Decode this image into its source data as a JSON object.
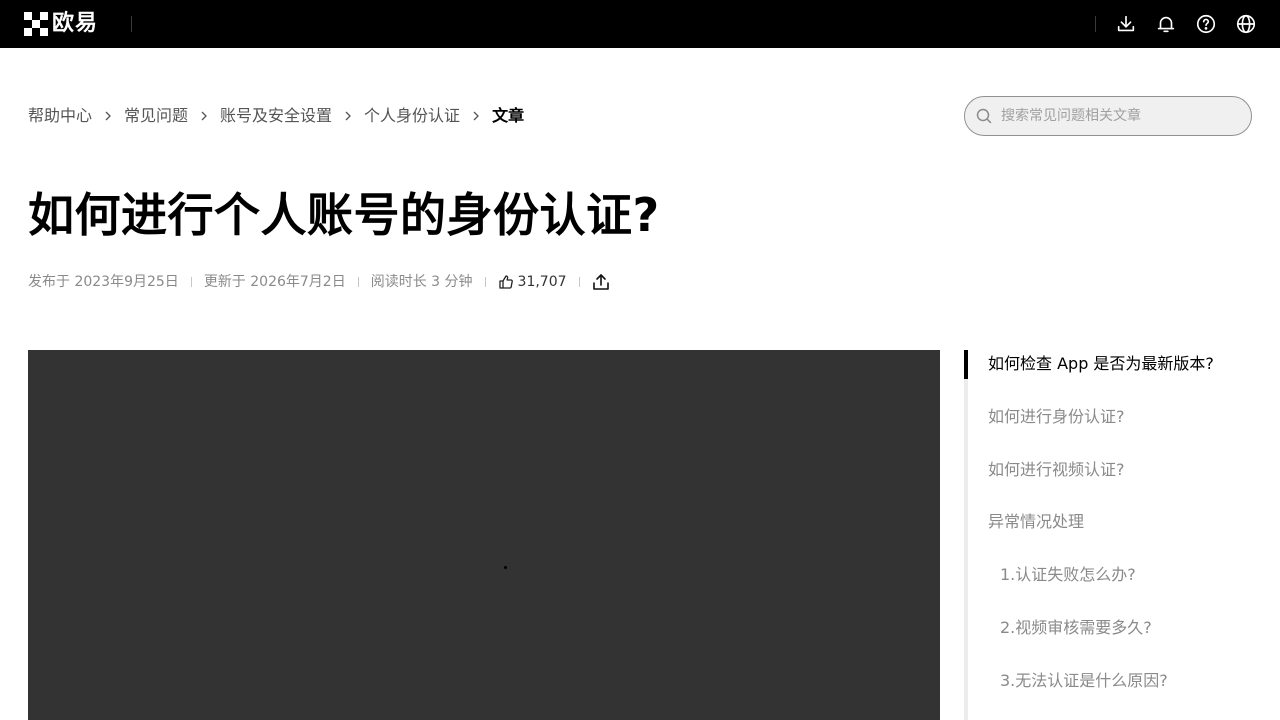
{
  "header": {
    "logo_text": "欧易",
    "icons": [
      "download-icon",
      "bell-icon",
      "help-icon",
      "globe-icon"
    ]
  },
  "breadcrumb": {
    "items": [
      "帮助中心",
      "常见问题",
      "账号及安全设置",
      "个人身份认证"
    ],
    "current": "文章"
  },
  "search": {
    "placeholder": "搜索常见问题相关文章"
  },
  "article": {
    "title": "如何进行个人账号的身份认证?",
    "published": "发布于 2023年9月25日",
    "updated": "更新于 2026年7月2日",
    "read_time": "阅读时长 3 分钟",
    "likes": "31,707"
  },
  "toc": {
    "items": [
      {
        "label": "如何检查 App 是否为最新版本?",
        "active": true
      },
      {
        "label": "如何进行身份认证?"
      },
      {
        "label": "如何进行视频认证?"
      },
      {
        "label": "异常情况处理"
      },
      {
        "label": "1.认证失败怎么办?"
      },
      {
        "label": "2.视频审核需要多久?"
      },
      {
        "label": "3.无法认证是什么原因?"
      }
    ]
  },
  "colors": {
    "nav_bg": "#000000",
    "video_bg": "#333333",
    "muted_text": "#8a8a8a",
    "search_bg": "#f0f0f0"
  }
}
